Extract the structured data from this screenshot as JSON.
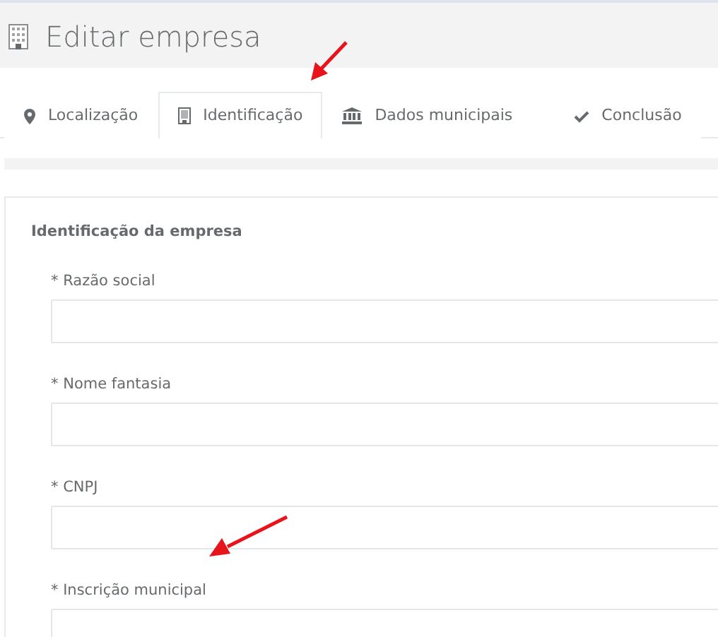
{
  "page": {
    "title": "Editar empresa"
  },
  "tabs": [
    {
      "label": "Localização",
      "selected": false
    },
    {
      "label": "Identificação",
      "selected": true
    },
    {
      "label": "Dados municipais",
      "selected": false
    },
    {
      "label": "Conclusão",
      "selected": false
    }
  ],
  "section": {
    "title": "Identificação da empresa"
  },
  "fields": [
    {
      "label": "* Razão social"
    },
    {
      "label": "* Nome fantasia"
    },
    {
      "label": "* CNPJ"
    },
    {
      "label": "* Inscrição municipal"
    }
  ]
}
